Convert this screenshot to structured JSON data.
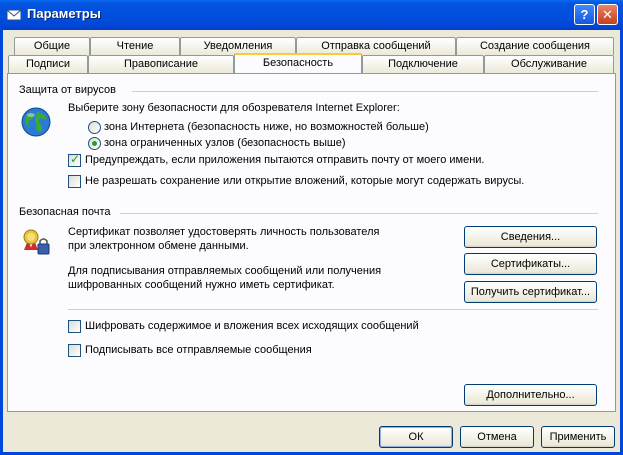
{
  "window": {
    "title": "Параметры",
    "help_label": "?",
    "close_label": "✕"
  },
  "tabs_row1": [
    "Общие",
    "Чтение",
    "Уведомления",
    "Отправка сообщений",
    "Создание сообщения"
  ],
  "tabs_row2": [
    "Подписи",
    "Правописание",
    "Безопасность",
    "Подключение",
    "Обслуживание"
  ],
  "active_tab": "Безопасность",
  "virus": {
    "group_label": "Защита от вирусов",
    "zone_prompt": "Выберите зону безопасности для обозревателя Internet Explorer:",
    "zone_internet": "зона Интернета (безопасность ниже, но возможностей больше)",
    "zone_restricted": "зона ограниченных узлов (безопасность выше)",
    "warn_send": "Предупреждать, если приложения пытаются отправить почту от моего имени.",
    "block_attachments": "Не разрешать сохранение или открытие вложений, которые могут содержать вирусы."
  },
  "secure_mail": {
    "group_label": "Безопасная почта",
    "cert_desc": "Сертификат позволяет удостоверять личность пользователя при электронном обмене данными.",
    "sign_desc": "Для подписывания отправляемых сообщений или получения шифрованных сообщений нужно иметь сертификат.",
    "info_button": "Сведения...",
    "certs_button": "Сертификаты...",
    "get_cert_button": "Получить сертификат...",
    "encrypt_all": "Шифровать содержимое и вложения всех исходящих сообщений",
    "sign_all": "Подписывать все отправляемые сообщения",
    "advanced_button": "Дополнительно..."
  },
  "footer": {
    "ok": "ОК",
    "cancel": "Отмена",
    "apply": "Применить"
  },
  "state": {
    "zone_selected": "restricted",
    "warn_send_checked": true,
    "block_attachments_checked": false,
    "encrypt_all_checked": false,
    "sign_all_checked": false
  },
  "icons": [
    "app-icon",
    "globe-icon",
    "certificate-icon"
  ]
}
